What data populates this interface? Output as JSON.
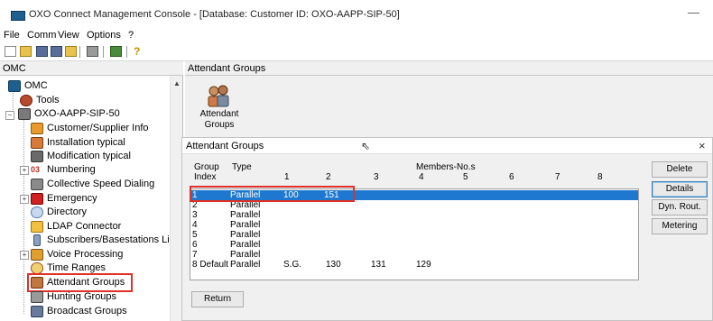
{
  "window": {
    "title": "OXO Connect Management Console - [Database:     Customer ID: OXO-AAPP-SIP-50]",
    "minimize_glyph": "—"
  },
  "menu": {
    "items": [
      "File",
      "Comm",
      "View",
      "Options",
      "?"
    ]
  },
  "toolbar": {
    "icons": [
      "new-document-icon",
      "open-folder-icon",
      "save-icon",
      "save-all-icon",
      "open-icon",
      "print-icon",
      "book-icon",
      "help-icon"
    ]
  },
  "left_pane": {
    "header": "OMC",
    "tree": [
      {
        "label": "OMC",
        "icon": "omc-root-icon",
        "expander": "−"
      },
      {
        "label": "Tools",
        "icon": "tools-icon"
      },
      {
        "label": "OXO-AAPP-SIP-50",
        "icon": "system-icon",
        "expander": "−"
      },
      {
        "label": "Customer/Supplier Info",
        "icon": "customer-info-icon"
      },
      {
        "label": "Installation typical",
        "icon": "installation-icon"
      },
      {
        "label": "Modification typical",
        "icon": "modification-icon"
      },
      {
        "label": "Numbering",
        "icon": "numbering-icon",
        "expander": "+"
      },
      {
        "label": "Collective Speed Dialing",
        "icon": "speed-dialing-icon"
      },
      {
        "label": "Emergency",
        "icon": "emergency-icon",
        "expander": "+"
      },
      {
        "label": "Directory",
        "icon": "directory-icon"
      },
      {
        "label": "LDAP Connector",
        "icon": "ldap-icon"
      },
      {
        "label": "Subscribers/Basestations List",
        "icon": "subscribers-icon"
      },
      {
        "label": "Voice Processing",
        "icon": "voice-processing-icon",
        "expander": "+"
      },
      {
        "label": "Time Ranges",
        "icon": "time-ranges-icon"
      },
      {
        "label": "Attendant Groups",
        "icon": "attendant-groups-icon",
        "highlighted": true
      },
      {
        "label": "Hunting Groups",
        "icon": "hunting-groups-icon"
      },
      {
        "label": "Broadcast Groups",
        "icon": "broadcast-groups-icon"
      }
    ],
    "numbering_prefix": "03"
  },
  "right_pane": {
    "header": "Attendant Groups",
    "icon_label_line1": "Attendant",
    "icon_label_line2": "Groups"
  },
  "dialog": {
    "title": "Attendant Groups",
    "close_glyph": "×",
    "headers": {
      "group_line1": "Group",
      "group_line2": "Index",
      "type": "Type",
      "members_title": "Members-No.s",
      "member_cols": [
        "1",
        "2",
        "3",
        "4",
        "5",
        "6",
        "7",
        "8"
      ]
    },
    "rows": [
      {
        "index": "1",
        "type": "Parallel",
        "m1": "100",
        "m2": "151",
        "m3": "",
        "m4": ""
      },
      {
        "index": "2",
        "type": "Parallel",
        "m1": "",
        "m2": "",
        "m3": "",
        "m4": ""
      },
      {
        "index": "3",
        "type": "Parallel",
        "m1": "",
        "m2": "",
        "m3": "",
        "m4": ""
      },
      {
        "index": "4",
        "type": "Parallel",
        "m1": "",
        "m2": "",
        "m3": "",
        "m4": ""
      },
      {
        "index": "5",
        "type": "Parallel",
        "m1": "",
        "m2": "",
        "m3": "",
        "m4": ""
      },
      {
        "index": "6",
        "type": "Parallel",
        "m1": "",
        "m2": "",
        "m3": "",
        "m4": ""
      },
      {
        "index": "7",
        "type": "Parallel",
        "m1": "",
        "m2": "",
        "m3": "",
        "m4": ""
      },
      {
        "index": "8 Default",
        "type": "Parallel",
        "m1": "S.G.",
        "m2": "130",
        "m3": "131",
        "m4": "129"
      }
    ],
    "buttons": {
      "delete": "Delete",
      "details": "Details",
      "dyn_rout": "Dyn. Rout.",
      "metering": "Metering",
      "return": "Return"
    }
  },
  "colors": {
    "selection": "#1e78d0",
    "highlight_box": "#e0302a",
    "panel_bg": "#f0f0f0"
  }
}
